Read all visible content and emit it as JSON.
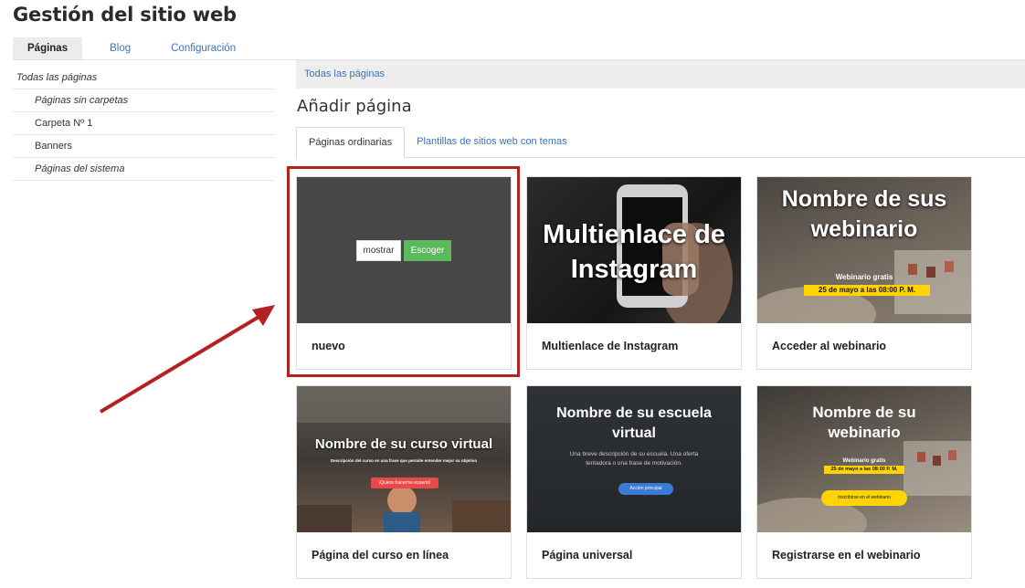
{
  "app": {
    "title": "Gestión del sitio web"
  },
  "top_tabs": [
    {
      "label": "Páginas",
      "active": true
    },
    {
      "label": "Blog",
      "active": false
    },
    {
      "label": "Configuración",
      "active": false
    }
  ],
  "sidebar": {
    "items": [
      {
        "label": "Todas las páginas"
      },
      {
        "label": "Páginas sin carpetas"
      },
      {
        "label": "Carpeta Nº 1"
      },
      {
        "label": "Banners"
      },
      {
        "label": "Páginas del sistema"
      }
    ]
  },
  "main": {
    "breadcrumb": "Todas las páginas",
    "heading": "Añadir página",
    "tabs": [
      {
        "label": "Páginas ordinarias",
        "active": true
      },
      {
        "label": "Plantillas de sitios web con temas",
        "active": false
      }
    ],
    "templates": [
      {
        "label": "nuevo",
        "show_label": "mostrar",
        "choose_label": "Escoger"
      },
      {
        "label": "Multienlace de Instagram",
        "thumb_title": "Multienlace de Instagram"
      },
      {
        "label": "Acceder al webinario",
        "thumb_title": "Nombre de sus webinario",
        "thumb_sub": "Webinario gratis",
        "thumb_date": "25 de mayo a las 08:00 P. M."
      },
      {
        "label": "Página del curso en línea",
        "thumb_title": "Nombre de su curso virtual",
        "thumb_sub": "Descripción del curso en una frase que permite entender mejor su objetivo",
        "thumb_btn": "¡Quiero hacerme experto!"
      },
      {
        "label": "Página universal",
        "thumb_title": "Nombre de su escuela virtual",
        "thumb_sub": "Una breve descripción de su escuela. Una oferta tentadora o una frase de motivación.",
        "thumb_btn": "Acción principal"
      },
      {
        "label": "Registrarse en el webinario",
        "thumb_title": "Nombre de su webinario",
        "thumb_sub": "Webinario gratis",
        "thumb_date": "25 de mayo a las 08:00 P. M.",
        "thumb_btn": "Inscribirse en el webinario"
      }
    ]
  },
  "colors": {
    "accent_link": "#3b73b9",
    "highlight": "#b52020",
    "choose_button": "#5cb85c",
    "blank_thumb": "#474747"
  }
}
